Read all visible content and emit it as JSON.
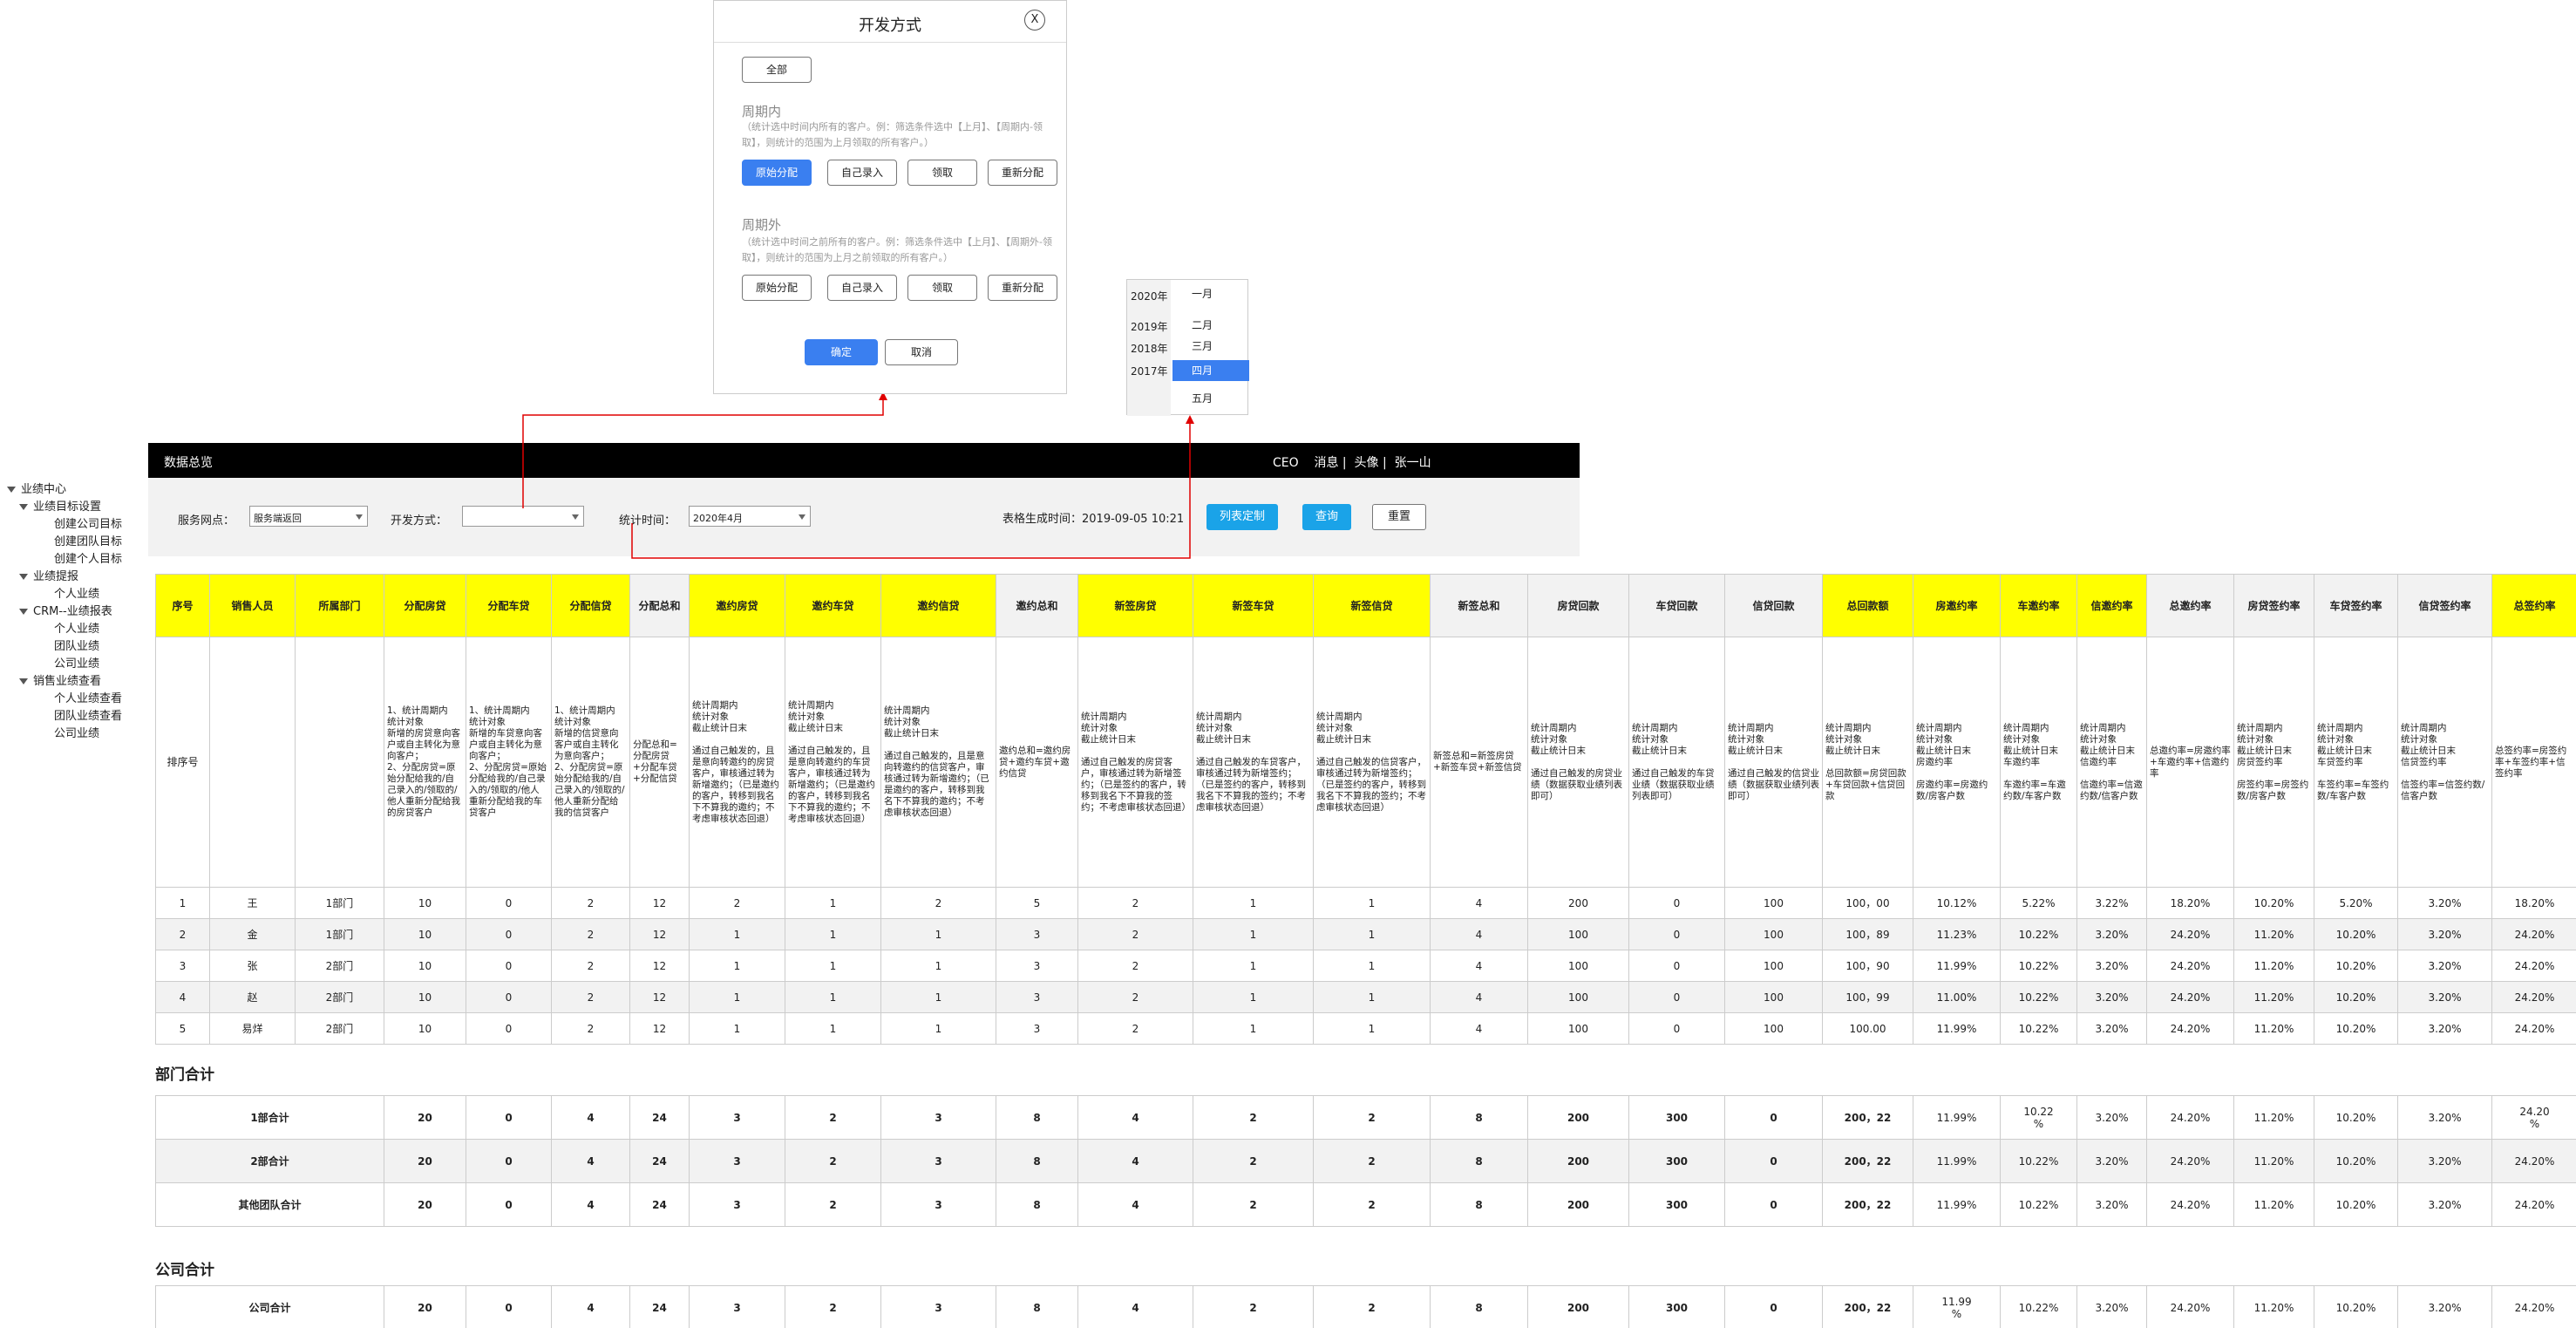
{
  "sidebar": {
    "items": [
      {
        "label": "业绩中心",
        "level": 0,
        "expanded": true
      },
      {
        "label": "业绩目标设置",
        "level": 1,
        "expanded": true
      },
      {
        "label": "创建公司目标",
        "level": 2
      },
      {
        "label": "创建团队目标",
        "level": 2
      },
      {
        "label": "创建个人目标",
        "level": 2
      },
      {
        "label": "业绩提报",
        "level": 1,
        "expanded": true
      },
      {
        "label": "个人业绩",
        "level": 2
      },
      {
        "label": "CRM--业绩报表",
        "level": 1,
        "expanded": true
      },
      {
        "label": "个人业绩",
        "level": 2
      },
      {
        "label": "团队业绩",
        "level": 2
      },
      {
        "label": "公司业绩",
        "level": 2
      },
      {
        "label": "销售业绩查看",
        "level": 1,
        "expanded": true
      },
      {
        "label": "个人业绩查看",
        "level": 2
      },
      {
        "label": "团队业绩查看",
        "level": 2
      },
      {
        "label": "公司业绩",
        "level": 2
      }
    ]
  },
  "topbar": {
    "title": "数据总览",
    "role": "CEO",
    "messages": "消息 |",
    "avatar": "头像 |",
    "user": "张一山"
  },
  "filters": {
    "service_label": "服务网点：",
    "service_value": "服务端返回",
    "dev_label": "开发方式：",
    "dev_value": "",
    "time_label": "统计时间：",
    "time_value": "2020年4月",
    "generated_label": "表格生成时间：",
    "generated_value": "2019-09-05 10:21",
    "btn_columns": "列表定制",
    "btn_query": "查询",
    "btn_reset": "重置"
  },
  "dialog": {
    "title": "开发方式",
    "close": "X",
    "all": "全部",
    "in_title": "周期内",
    "in_desc": "（统计选中时间内所有的客户。例：筛选条件选中【上月】、【周期内-领取】，则统计的范围为上月领取的所有客户。）",
    "in_buttons": [
      "原始分配",
      "自己录入",
      "领取",
      "重新分配"
    ],
    "out_title": "周期外",
    "out_desc": "（统计选中时间之前所有的客户。例：筛选条件选中【上月】、【周期外-领取】，则统计的范围为上月之前领取的所有客户。）",
    "out_buttons": [
      "原始分配",
      "自己录入",
      "领取",
      "重新分配"
    ],
    "ok": "确定",
    "cancel": "取消"
  },
  "picker": {
    "years": [
      "2020年",
      "2019年",
      "2018年",
      "2017年"
    ],
    "months": [
      "一月",
      "二月",
      "三月",
      "四月",
      "五月"
    ],
    "selected_month": "四月"
  },
  "table": {
    "headers": [
      "序号",
      "销售人员",
      "所属部门",
      "分配房贷",
      "分配车贷",
      "分配信贷",
      "分配总和",
      "邀约房贷",
      "邀约车贷",
      "邀约信贷",
      "邀约总和",
      "新签房贷",
      "新签车贷",
      "新签信贷",
      "新签总和",
      "房贷回款",
      "车贷回款",
      "信贷回款",
      "总回款额",
      "房邀约率",
      "车邀约率",
      "信邀约率",
      "总邀约率",
      "房贷签约率",
      "车贷签约率",
      "信贷签约率",
      "总签约率"
    ],
    "descriptions": [
      "排序号",
      "",
      "",
      "1、统计周期内\n统计对象\n新增的房贷意向客户或自主转化为意向客户；\n2、分配房贷=原始分配给我的/自己录入的/领取的/他人重新分配给我的房贷客户",
      "1、统计周期内\n统计对象\n新增的车贷意向客户或自主转化为意向客户；\n2、分配房贷=原始分配给我的/自己录入的/领取的/他人重新分配给我的车贷客户",
      "1、统计周期内\n统计对象\n新增的信贷意向客户或自主转化为意向客户；\n2、分配房贷=原始分配给我的/自己录入的/领取的/他人重新分配给我的信贷客户",
      "分配总和=分配房贷+分配车贷+分配信贷",
      "统计周期内\n统计对象\n截止统计日末\n\n通过自己触发的，且是意向转邀约的房贷客户，审核通过转为新增邀约；（已是邀约的客户，转移到我名下不算我的邀约；不考虑审核状态回退）",
      "统计周期内\n统计对象\n截止统计日末\n\n通过自己触发的，且是意向转邀约的车贷客户，审核通过转为新增邀约；（已是邀约的客户，转移到我名下不算我的邀约；不考虑审核状态回退）",
      "统计周期内\n统计对象\n截止统计日末\n\n通过自己触发的，且是意向转邀约的信贷客户，审核通过转为新增邀约；（已是邀约的客户，转移到我名下不算我的邀约；不考虑审核状态回退）",
      "邀约总和=邀约房贷+邀约车贷+邀约信贷",
      "统计周期内\n统计对象\n截止统计日末\n\n通过自己触发的房贷客户，审核通过转为新增签约；（已是签约的客户，转移到我名下不算我的签约；不考虑审核状态回退）",
      "统计周期内\n统计对象\n截止统计日末\n\n通过自己触发的车贷客户，审核通过转为新增签约；（已是签约的客户，转移到我名下不算我的签约；不考虑审核状态回退）",
      "统计周期内\n统计对象\n截止统计日末\n\n通过自己触发的信贷客户，审核通过转为新增签约；（已是签约的客户，转移到我名下不算我的签约；不考虑审核状态回退）",
      "新签总和=新签房贷+新签车贷+新签信贷",
      "统计周期内\n统计对象\n截止统计日末\n\n通过自己触发的房贷业绩（数据获取业绩列表即可）",
      "统计周期内\n统计对象\n截止统计日末\n\n通过自己触发的车贷业绩（数据获取业绩列表即可）",
      "统计周期内\n统计对象\n截止统计日末\n\n通过自己触发的信贷业绩（数据获取业绩列表即可）",
      "统计周期内\n统计对象\n截止统计日末\n\n总回款额=房贷回款+车贷回款+信贷回款",
      "统计周期内\n统计对象\n截止统计日末\n房邀约率\n\n房邀约率=房邀约数/房客户数",
      "统计周期内\n统计对象\n截止统计日末\n车邀约率\n\n车邀约率=车邀约数/车客户数",
      "统计周期内\n统计对象\n截止统计日末\n信邀约率\n\n信邀约率=信邀约数/信客户数",
      "总邀约率=房邀约率+车邀约率+信邀约率",
      "统计周期内\n统计对象\n截止统计日末\n房贷签约率\n\n房签约率=房签约数/房客户数",
      "统计周期内\n统计对象\n截止统计日末\n车贷签约率\n\n车签约率=车签约数/车客户数",
      "统计周期内\n统计对象\n截止统计日末\n信贷签约率\n\n信签约率=信签约数/信客户数",
      "总签约率=房签约率+车签约率+信签约率"
    ],
    "rows": [
      [
        "1",
        "王",
        "1部门",
        "10",
        "0",
        "2",
        "12",
        "2",
        "1",
        "2",
        "5",
        "2",
        "1",
        "1",
        "4",
        "200",
        "0",
        "100",
        "100，00",
        "10.12%",
        "5.22%",
        "3.22%",
        "18.20%",
        "10.20%",
        "5.20%",
        "3.20%",
        "18.20%"
      ],
      [
        "2",
        "金",
        "1部门",
        "10",
        "0",
        "2",
        "12",
        "1",
        "1",
        "1",
        "3",
        "2",
        "1",
        "1",
        "4",
        "100",
        "0",
        "100",
        "100，89",
        "11.23%",
        "10.22%",
        "3.20%",
        "24.20%",
        "11.20%",
        "10.20%",
        "3.20%",
        "24.20%"
      ],
      [
        "3",
        "张",
        "2部门",
        "10",
        "0",
        "2",
        "12",
        "1",
        "1",
        "1",
        "3",
        "2",
        "1",
        "1",
        "4",
        "100",
        "0",
        "100",
        "100，90",
        "11.99%",
        "10.22%",
        "3.20%",
        "24.20%",
        "11.20%",
        "10.20%",
        "3.20%",
        "24.20%"
      ],
      [
        "4",
        "赵",
        "2部门",
        "10",
        "0",
        "2",
        "12",
        "1",
        "1",
        "1",
        "3",
        "2",
        "1",
        "1",
        "4",
        "100",
        "0",
        "100",
        "100，99",
        "11.00%",
        "10.22%",
        "3.20%",
        "24.20%",
        "11.20%",
        "10.20%",
        "3.20%",
        "24.20%"
      ],
      [
        "5",
        "易烊",
        "2部门",
        "10",
        "0",
        "2",
        "12",
        "1",
        "1",
        "1",
        "3",
        "2",
        "1",
        "1",
        "4",
        "100",
        "0",
        "100",
        "100.00",
        "11.99%",
        "10.22%",
        "3.20%",
        "24.20%",
        "11.20%",
        "10.20%",
        "3.20%",
        "24.20%"
      ]
    ]
  },
  "dept_section": {
    "title": "部门合计",
    "rows": [
      [
        "1部合计",
        "20",
        "0",
        "4",
        "24",
        "3",
        "2",
        "3",
        "8",
        "4",
        "2",
        "2",
        "8",
        "200",
        "300",
        "0",
        "200，22",
        "11.99%",
        "10.22\n%",
        "3.20%",
        "24.20%",
        "11.20%",
        "10.20%",
        "3.20%",
        "24.20\n%"
      ],
      [
        "2部合计",
        "20",
        "0",
        "4",
        "24",
        "3",
        "2",
        "3",
        "8",
        "4",
        "2",
        "2",
        "8",
        "200",
        "300",
        "0",
        "200，22",
        "11.99%",
        "10.22%",
        "3.20%",
        "24.20%",
        "11.20%",
        "10.20%",
        "3.20%",
        "24.20%"
      ],
      [
        "其他团队合计",
        "20",
        "0",
        "4",
        "24",
        "3",
        "2",
        "3",
        "8",
        "4",
        "2",
        "2",
        "8",
        "200",
        "300",
        "0",
        "200，22",
        "11.99%",
        "10.22%",
        "3.20%",
        "24.20%",
        "11.20%",
        "10.20%",
        "3.20%",
        "24.20%"
      ]
    ]
  },
  "company_section": {
    "title": "公司合计",
    "rows": [
      [
        "公司合计",
        "20",
        "0",
        "4",
        "24",
        "3",
        "2",
        "3",
        "8",
        "4",
        "2",
        "2",
        "8",
        "200",
        "300",
        "0",
        "200，22",
        "11.99\n%",
        "10.22%",
        "3.20%",
        "24.20%",
        "11.20%",
        "10.20%",
        "3.20%",
        "24.20%"
      ]
    ]
  },
  "colors": {
    "header_yellow": "#ffff00",
    "topbar": "#000000",
    "primary_blue": "#1aa3e8",
    "dialog_blue": "#3a7ff0",
    "arrow_red": "#e00000"
  }
}
